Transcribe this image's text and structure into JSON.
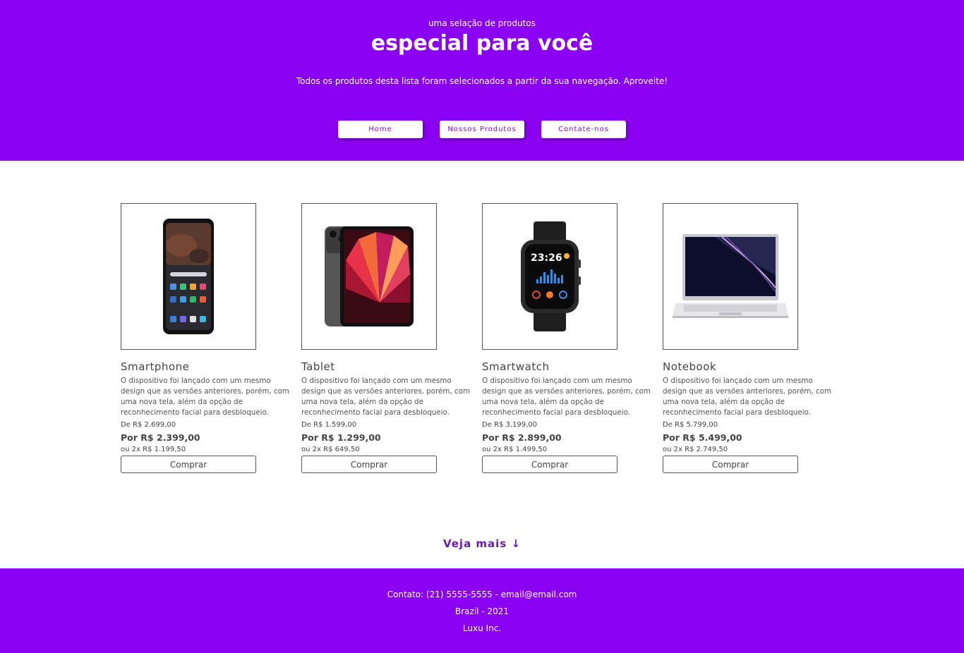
{
  "header": {
    "kicker": "uma selação de produtos",
    "title": "especial para você",
    "subtitle": "Todos os produtos desta lista foram selecionados a partir da sua navegação. Aproveite!",
    "nav": [
      "Home",
      "Nossos Produtos",
      "Contate-nos"
    ]
  },
  "products": [
    {
      "name": "Smartphone",
      "image_icon": "smartphone-image",
      "description": "O dispositivo foi lançado com um mesmo design que as versões anteriores, porém, com uma nova tela, além da opção de reconhecimento facial para desbloqueio.",
      "old_price": "De R$ 2.699,00",
      "price": "Por R$ 2.399,00",
      "installments": "ou 2x R$ 1.199,50",
      "button": "Comprar"
    },
    {
      "name": "Tablet",
      "image_icon": "tablet-image",
      "description": "O dispositivo foi lançado com um mesmo design que as versões anteriores, porém, com uma nova tela, além da opção de reconhecimento facial para desbloqueio.",
      "old_price": "De R$ 1.599,00",
      "price": "Por R$ 1.299,00",
      "installments": "ou 2x R$ 649,50",
      "button": "Comprar"
    },
    {
      "name": "Smartwatch",
      "image_icon": "smartwatch-image",
      "description": "O dispositivo foi lançado com um mesmo design que as versões anteriores, porém, com uma nova tela, além da opção de reconhecimento facial para desbloqueio.",
      "old_price": "De R$ 3.199,00",
      "price": "Por R$ 2.899,00",
      "installments": "ou 2x R$ 1.499,50",
      "button": "Comprar",
      "watch_time": "23:26"
    },
    {
      "name": "Notebook",
      "image_icon": "notebook-image",
      "description": "O dispositivo foi lançado com um mesmo design que as versões anteriores, porém, com uma nova tela, além da opção de reconhecimento facial para desbloqueio.",
      "old_price": "De R$ 5.799,00",
      "price": "Por R$ 5.499,00",
      "installments": "ou 2x R$ 2.749,50",
      "button": "Comprar"
    }
  ],
  "more": "Veja mais ↓",
  "footer": {
    "contact": "Contato: (21) 5555-5555 - email@email.com",
    "location": "Brazil - 2021",
    "company": "Luxu Inc."
  },
  "colors": {
    "brand": "#8a00f0",
    "link": "#6a1ca8"
  }
}
